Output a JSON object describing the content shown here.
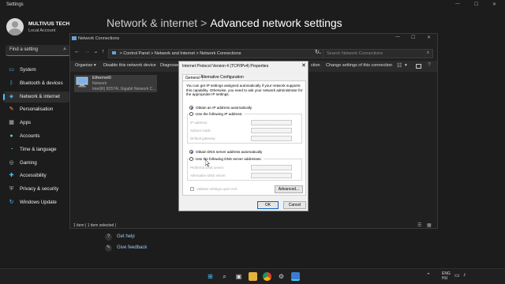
{
  "settings": {
    "window_title": "Settings",
    "account": {
      "name": "MULTIVUS TECH",
      "type": "Local Account"
    },
    "search_placeholder": "Find a setting",
    "nav": [
      {
        "label": "System",
        "icon": "system-icon"
      },
      {
        "label": "Bluetooth & devices",
        "icon": "bluetooth-icon"
      },
      {
        "label": "Network & internet",
        "icon": "wifi-icon",
        "selected": true
      },
      {
        "label": "Personalisation",
        "icon": "brush-icon"
      },
      {
        "label": "Apps",
        "icon": "apps-icon"
      },
      {
        "label": "Accounts",
        "icon": "person-icon"
      },
      {
        "label": "Time & language",
        "icon": "globe-clock-icon"
      },
      {
        "label": "Gaming",
        "icon": "gamepad-icon"
      },
      {
        "label": "Accessibility",
        "icon": "accessibility-icon"
      },
      {
        "label": "Privacy & security",
        "icon": "shield-icon"
      },
      {
        "label": "Windows Update",
        "icon": "update-icon"
      }
    ],
    "breadcrumb_parent": "Network & internet",
    "breadcrumb_sep": ">",
    "page_title": "Advanced network settings",
    "get_help": "Get help",
    "give_feedback": "Give feedback"
  },
  "network_connections": {
    "window_title": "Network Connections",
    "address_path": [
      ">",
      "Control Panel",
      ">",
      "Network and Internet",
      ">",
      "Network Connections"
    ],
    "search_placeholder": "Search Network Connections",
    "toolbar": {
      "organise": "Organise ▾",
      "disable": "Disable this network device",
      "diagnose": "Diagnose",
      "connection": "ction",
      "change_settings": "Change settings of this connection"
    },
    "adapter": {
      "name": "Ethernet0",
      "network": "Network",
      "device": "Intel(R) 82574L Gigabit Network C..."
    },
    "status_bar": "1 item   |   1 item selected   |"
  },
  "ipv4_dialog": {
    "title": "Internet Protocol Version 4 (TCP/IPv4) Properties",
    "tabs": [
      "General",
      "Alternative Configuration"
    ],
    "description": "You can get IP settings assigned automatically if your network supports this capability. Otherwise, you need to ask your network administrator for the appropriate IP settings.",
    "obtain_ip_auto": "Obtain an IP address automatically",
    "use_following_ip": "Use the following IP address:",
    "ip_address_label": "IP address:",
    "subnet_label": "Subnet mask:",
    "gateway_label": "Default gateway:",
    "obtain_dns_auto": "Obtain DNS server address automatically",
    "use_following_dns": "Use the following DNS server addresses:",
    "preferred_dns_label": "Preferred DNS server:",
    "alternative_dns_label": "Alternative DNS server:",
    "ip_placeholder": ". . .",
    "validate_label": "Validate settings upon exit",
    "advanced_button": "Advanced...",
    "ok_button": "OK",
    "cancel_button": "Cancel",
    "ip_mode": "automatic",
    "dns_mode": "automatic"
  },
  "taskbar": {
    "language": "ENG",
    "region": "HU"
  },
  "colors": {
    "accent": "#4cc2ff",
    "dialog_bg": "#f0f0f0",
    "radio_selected": "#0a64c8"
  }
}
